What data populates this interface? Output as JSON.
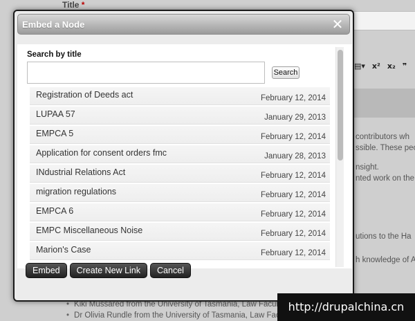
{
  "background": {
    "title_label": "Title",
    "required_mark": "*",
    "toolbar_glyphs": [
      "▤▾",
      "x²",
      "x₂",
      "❞"
    ],
    "text_lines": [
      "contributors wh",
      "ssible. These peo",
      "nsight.",
      "nted work on the",
      "utions to the Ha",
      "h knowledge of A"
    ],
    "bullets": [
      "Kiki Mussared from the University of Tasmania, Law Faculty",
      "Dr Olivia Rundle from the University of Tasmania, Law Faculty"
    ]
  },
  "dialog": {
    "title": "Embed a Node",
    "close_glyph": "✕",
    "search_label": "Search by title",
    "search_value": "",
    "search_placeholder": "",
    "search_button": "Search",
    "results": [
      {
        "title": "Registration of Deeds act",
        "date": "February 12, 2014"
      },
      {
        "title": "LUPAA 57",
        "date": "January 29, 2013"
      },
      {
        "title": "EMPCA 5",
        "date": "February 12, 2014"
      },
      {
        "title": "Application for consent orders fmc",
        "date": "January 28, 2013"
      },
      {
        "title": "INdustrial Relations Act",
        "date": "February 12, 2014"
      },
      {
        "title": "migration regulations",
        "date": "February 12, 2014"
      },
      {
        "title": "EMPCA 6",
        "date": "February 12, 2014"
      },
      {
        "title": "EMPC Miscellaneous Noise",
        "date": "February 12, 2014"
      },
      {
        "title": "Marion's Case",
        "date": "February 12, 2014"
      }
    ],
    "buttons": {
      "embed": "Embed",
      "create_new_link": "Create New Link",
      "cancel": "Cancel"
    }
  },
  "watermark": "http://drupalchina.cn"
}
